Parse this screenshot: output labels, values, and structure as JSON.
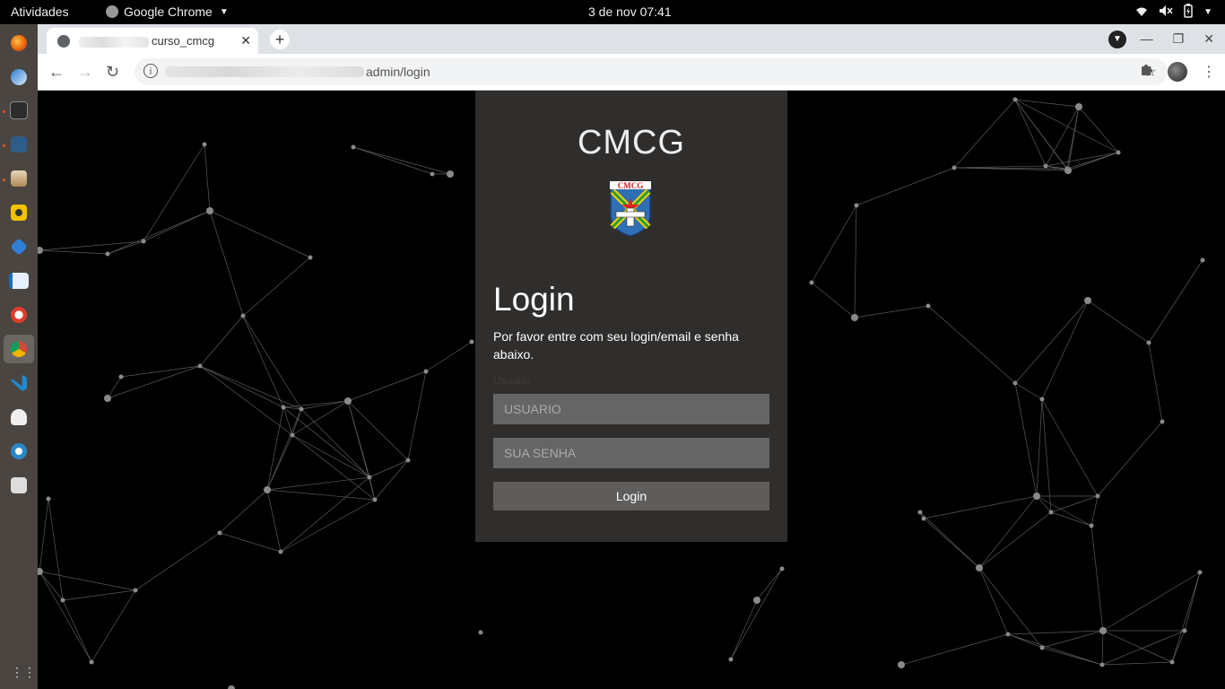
{
  "topbar": {
    "activities": "Atividades",
    "app_name": "Google Chrome",
    "clock": "3 de nov  07:41"
  },
  "dock": {
    "apps": [
      "firefox-icon",
      "thunderbird-icon",
      "terminal-icon",
      "monitor-icon",
      "files-icon",
      "rhythmbox-icon",
      "vscode-alt-icon",
      "writer-icon",
      "help-icon",
      "chrome-icon",
      "vscode-icon",
      "gimp-icon",
      "settings-icon",
      "installer-icon"
    ]
  },
  "browser": {
    "tab_title": "curso_cmcg",
    "url_visible": "admin/login"
  },
  "page": {
    "brand": "CMCG",
    "emblem_text": "CMCG",
    "title": "Login",
    "subtitle": "Por favor entre com seu login/email e senha abaixo.",
    "ghost_label": "Usuario",
    "username_placeholder": "USUARIO",
    "password_placeholder": "SUA SENHA",
    "login_button": "Login"
  },
  "colors": {
    "panel_bg": "#302e2c",
    "field_bg": "#666565",
    "button_bg": "#5e5d5c",
    "dock_bg": "#4a4540"
  }
}
